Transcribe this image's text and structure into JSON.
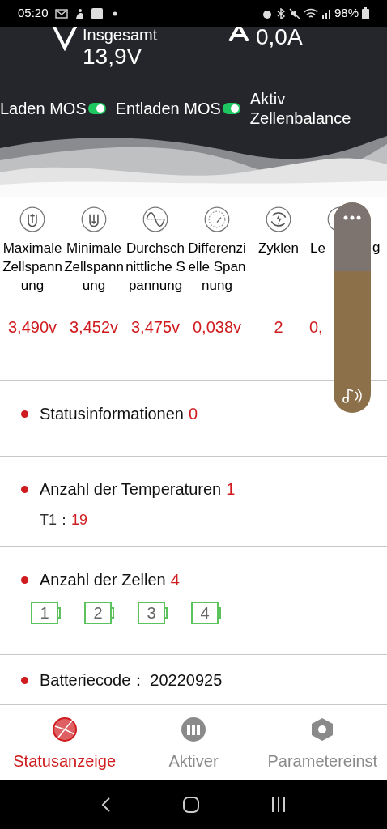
{
  "status_bar": {
    "time": "05:20",
    "battery": "98%"
  },
  "header": {
    "voltage_label": "Insgesamt",
    "voltage": "13,9V",
    "current": "0,0A",
    "switches": [
      {
        "label": "Laden MOS",
        "on": true
      },
      {
        "label": "Entladen MOS",
        "on": true
      }
    ],
    "balance_label": "Aktiv Zellenbalance"
  },
  "metrics": [
    {
      "kind": "max",
      "label": "Maximale Zellspannung",
      "value": "3,490v"
    },
    {
      "kind": "min",
      "label": "Minimale Zellspannung",
      "value": "3,452v"
    },
    {
      "kind": "avg",
      "label": "Durchschnittliche Spannung",
      "value": "3,475v"
    },
    {
      "kind": "diff",
      "label": "Differenzielle Spannung",
      "value": "0,038v"
    },
    {
      "kind": "cycles",
      "label": "Zyklen",
      "value": "2"
    },
    {
      "kind": "power",
      "label": "Le",
      "label_end": "g",
      "value": "0,"
    }
  ],
  "sections": [
    {
      "kind": "status",
      "title": "Statusinformationen",
      "count": "0"
    },
    {
      "kind": "temps",
      "title": "Anzahl der Temperaturen",
      "count": "1",
      "temps": [
        {
          "label": "T1：",
          "value": "19"
        }
      ]
    },
    {
      "kind": "cells",
      "title": "Anzahl der Zellen",
      "count": "4",
      "cells": [
        "1",
        "2",
        "3",
        "4"
      ]
    },
    {
      "kind": "code",
      "title": "Batteriecode：",
      "value": "20220925"
    }
  ],
  "tabs": [
    {
      "label": "Statusanzeige",
      "selected": true
    },
    {
      "label": "Aktiver",
      "selected": false
    },
    {
      "label": "Parametereinst",
      "selected": false
    }
  ]
}
